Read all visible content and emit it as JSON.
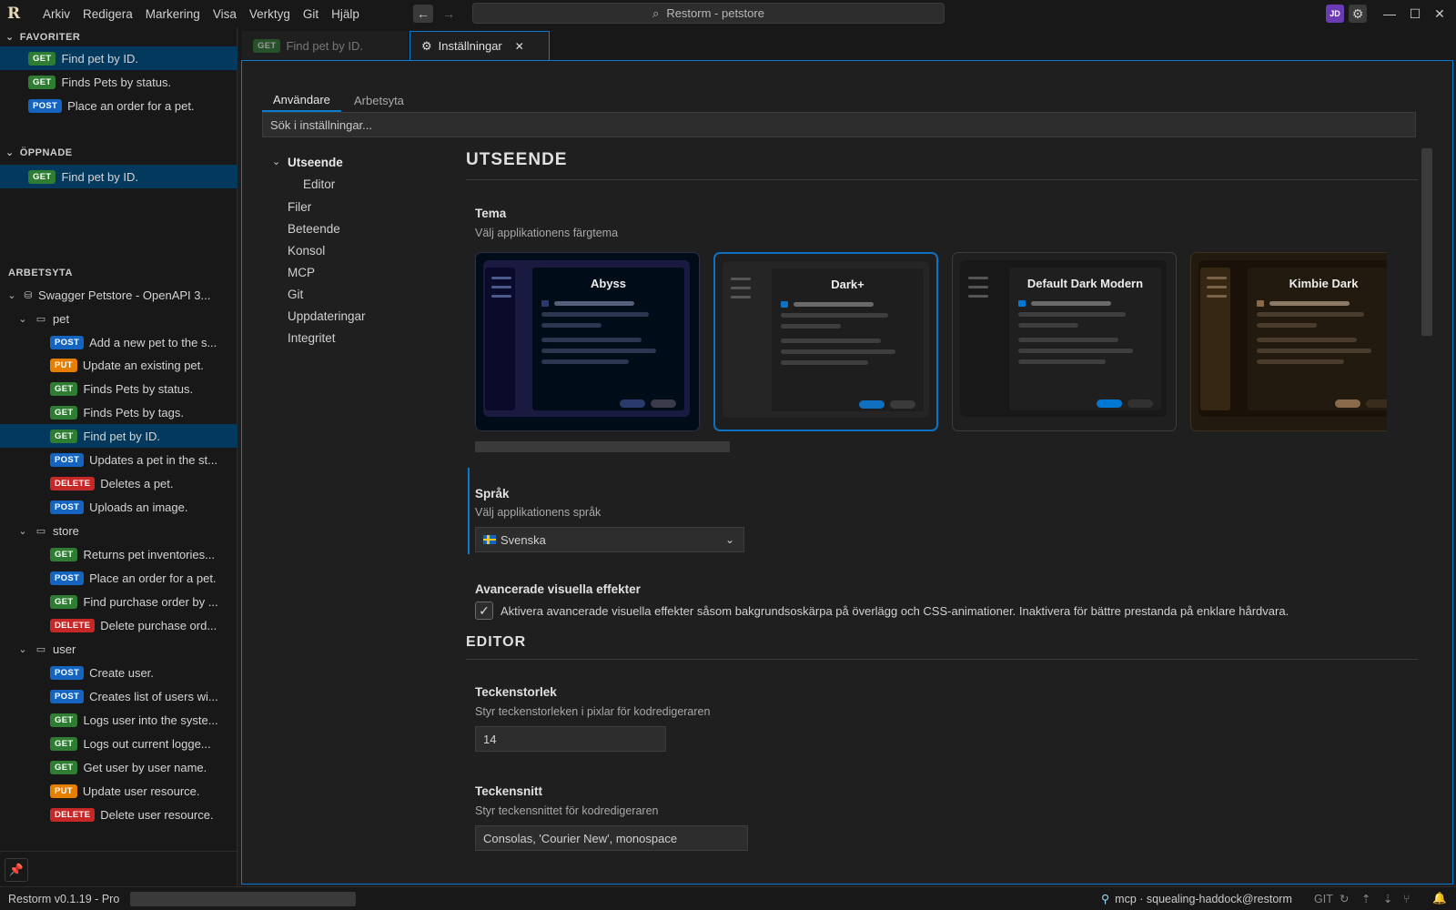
{
  "menu": [
    "Arkiv",
    "Redigera",
    "Markering",
    "Visa",
    "Verktyg",
    "Git",
    "Hjälp"
  ],
  "search": {
    "text": "Restorm - petstore"
  },
  "user": {
    "initials": "JD"
  },
  "sidebar": {
    "favorites_title": "FAVORITER",
    "favorites": [
      {
        "method": "GET",
        "label": "Find pet by ID.",
        "selected": true
      },
      {
        "method": "GET",
        "label": "Finds Pets by status."
      },
      {
        "method": "POST",
        "label": "Place an order for a pet."
      }
    ],
    "opened_title": "ÖPPNADE",
    "opened": [
      {
        "method": "GET",
        "label": "Find pet by ID.",
        "selected": true
      }
    ],
    "workspace_title": "ARBETSYTA",
    "project": "Swagger Petstore - OpenAPI 3...",
    "folders": [
      {
        "name": "pet",
        "items": [
          {
            "method": "POST",
            "label": "Add a new pet to the s..."
          },
          {
            "method": "PUT",
            "label": "Update an existing pet."
          },
          {
            "method": "GET",
            "label": "Finds Pets by status."
          },
          {
            "method": "GET",
            "label": "Finds Pets by tags."
          },
          {
            "method": "GET",
            "label": "Find pet by ID.",
            "selected": true
          },
          {
            "method": "POST",
            "label": "Updates a pet in the st..."
          },
          {
            "method": "DELETE",
            "label": "Deletes a pet."
          },
          {
            "method": "POST",
            "label": "Uploads an image."
          }
        ]
      },
      {
        "name": "store",
        "items": [
          {
            "method": "GET",
            "label": "Returns pet inventories..."
          },
          {
            "method": "POST",
            "label": "Place an order for a pet."
          },
          {
            "method": "GET",
            "label": "Find purchase order by ..."
          },
          {
            "method": "DELETE",
            "label": "Delete purchase ord..."
          }
        ]
      },
      {
        "name": "user",
        "items": [
          {
            "method": "POST",
            "label": "Create user."
          },
          {
            "method": "POST",
            "label": "Creates list of users wi..."
          },
          {
            "method": "GET",
            "label": "Logs user into the syste..."
          },
          {
            "method": "GET",
            "label": "Logs out current logge..."
          },
          {
            "method": "GET",
            "label": "Get user by user name."
          },
          {
            "method": "PUT",
            "label": "Update user resource."
          },
          {
            "method": "DELETE",
            "label": "Delete user resource."
          }
        ]
      }
    ]
  },
  "tabs": [
    {
      "method": "GET",
      "label": "Find pet by ID."
    },
    {
      "label": "Inställningar",
      "icon": "gear-icon",
      "active": true
    }
  ],
  "settings": {
    "scope_tabs": [
      "Användare",
      "Arbetsyta"
    ],
    "search_placeholder": "Sök i inställningar...",
    "nav": {
      "appearance": "Utseende",
      "editor": "Editor",
      "files": "Filer",
      "behavior": "Beteende",
      "console": "Konsol",
      "mcp": "MCP",
      "git": "Git",
      "updates": "Uppdateringar",
      "privacy": "Integritet"
    },
    "appearance_heading": "UTSEENDE",
    "theme_label": "Tema",
    "theme_desc": "Välj applikationens färgtema",
    "themes": [
      {
        "name": "Abyss",
        "accent": "#2a3a6a"
      },
      {
        "name": "Dark+",
        "accent": "#0e70c0",
        "selected": true
      },
      {
        "name": "Default Dark Modern",
        "accent": "#0078d4"
      },
      {
        "name": "Kimbie Dark",
        "accent": "#8a6a4a"
      }
    ],
    "language_label": "Språk",
    "language_desc": "Välj applikationens språk",
    "language_value": "Svenska",
    "effects_label": "Avancerade visuella effekter",
    "effects_checkbox": "Aktivera avancerade visuella effekter såsom bakgrundsoskärpa på överlägg och CSS-animationer. Inaktivera för bättre prestanda på enklare hårdvara.",
    "effects_checked": true,
    "editor_heading": "EDITOR",
    "fontsize_label": "Teckenstorlek",
    "fontsize_desc": "Styr teckenstorleken i pixlar för kodredigeraren",
    "fontsize_value": "14",
    "font_label": "Teckensnitt",
    "font_desc": "Styr teckensnittet för kodredigeraren",
    "font_value": "Consolas, 'Courier New', monospace"
  },
  "status": {
    "version": "Restorm v0.1.19 - Pro",
    "mcp": "mcp · squealing-haddock@restorm",
    "git": "GIT"
  },
  "colors": {
    "accent": "#0a7acc",
    "selected_row": "#04395e",
    "get": "#2e7d32",
    "post": "#1565c0",
    "put": "#e67e00",
    "delete": "#c62828"
  }
}
